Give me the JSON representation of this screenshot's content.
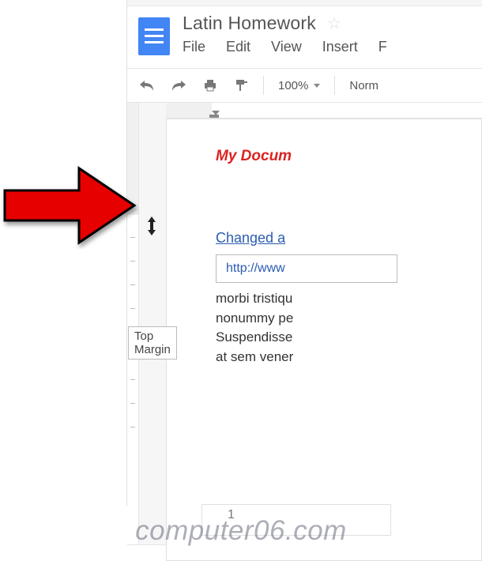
{
  "doc_title": "Latin Homework",
  "menu": {
    "file": "File",
    "edit": "Edit",
    "view": "View",
    "insert": "Insert",
    "more": "F"
  },
  "toolbar": {
    "zoom": "100%",
    "style": "Norm"
  },
  "tooltip": "Top Margin",
  "document": {
    "title": "My Docum",
    "heading": "Changed a",
    "url": "http://www",
    "body_lines": [
      "morbi tristiqu",
      "nonummy pe",
      "Suspendisse",
      "at sem vener"
    ]
  },
  "page2_number": "1",
  "watermark": "computer06.com"
}
